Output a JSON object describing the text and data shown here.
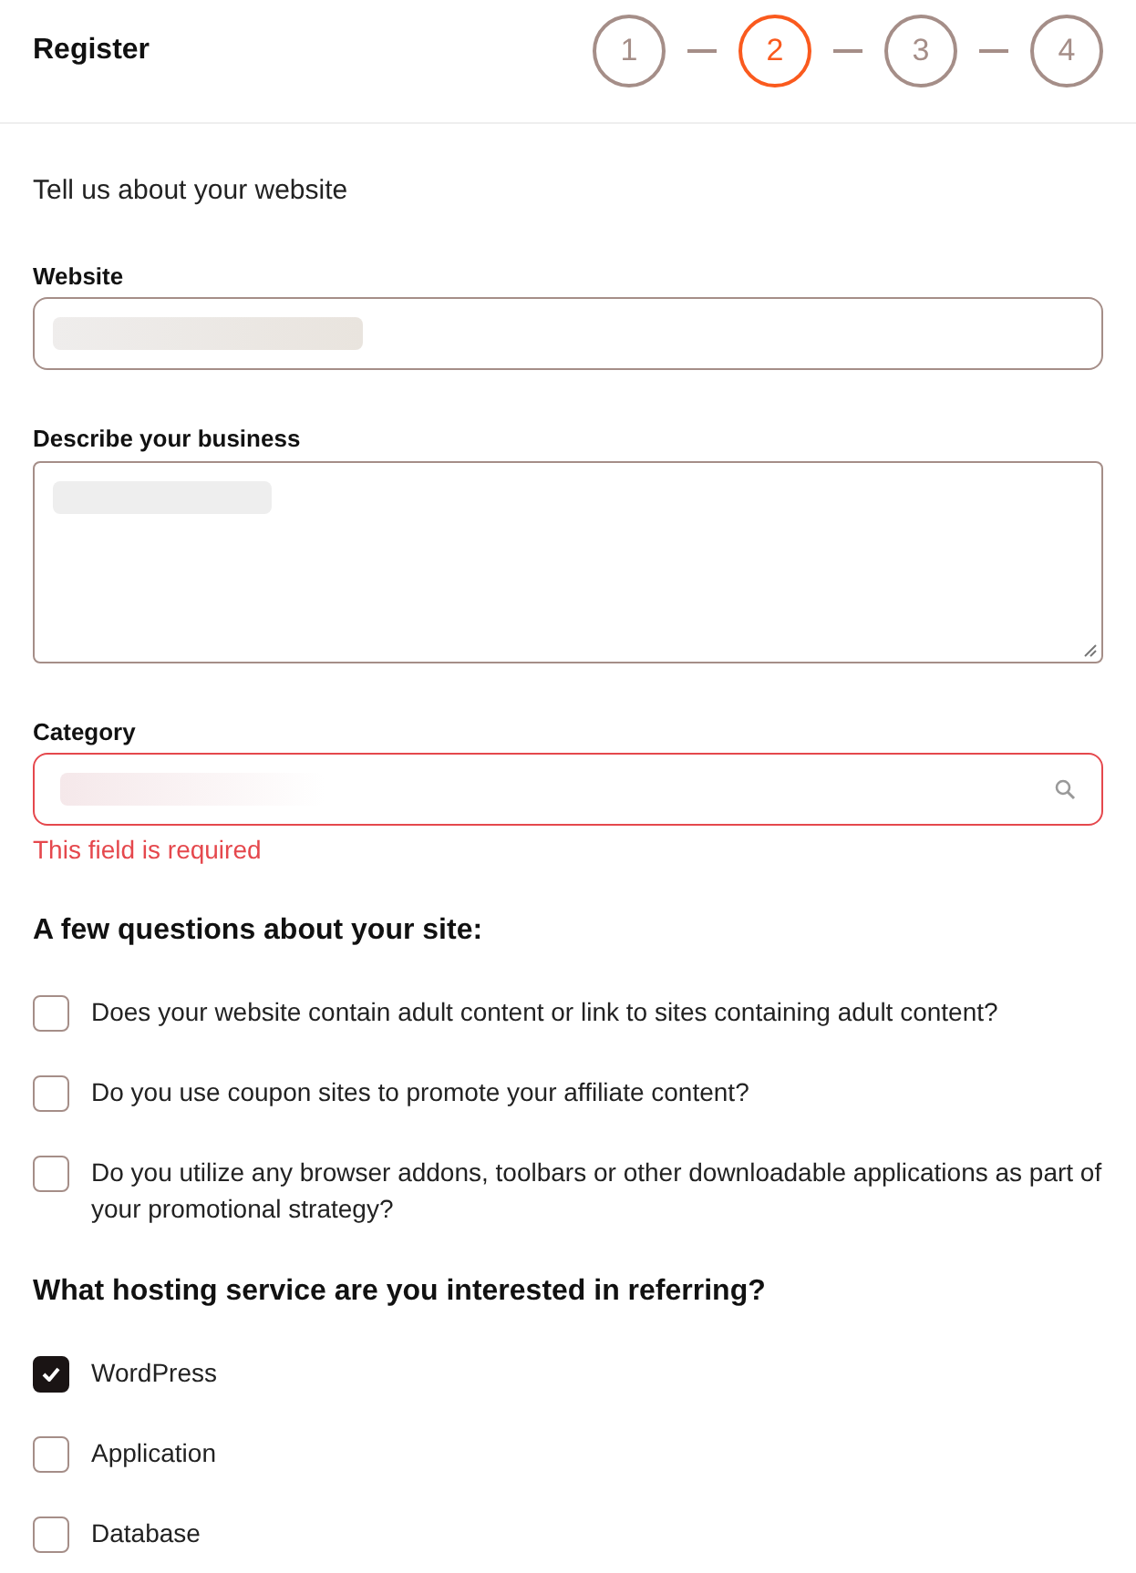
{
  "header": {
    "title": "Register",
    "steps": [
      {
        "label": "1",
        "selected": false
      },
      {
        "label": "2",
        "selected": true
      },
      {
        "label": "3",
        "selected": false
      },
      {
        "label": "4",
        "selected": false
      }
    ]
  },
  "form": {
    "heading": "Tell us about your website",
    "website": {
      "label": "Website"
    },
    "description": {
      "label": "Describe your business"
    },
    "category": {
      "label": "Category",
      "error": "This field is required"
    }
  },
  "questions": {
    "heading": "A few questions about your site:",
    "items": [
      {
        "label": "Does your website contain adult content or link to sites containing adult content?",
        "checked": false
      },
      {
        "label": "Do you use coupon sites to promote your affiliate content?",
        "checked": false
      },
      {
        "label": "Do you utilize any browser addons, toolbars or other downloadable applications as part of your promotional strategy?",
        "checked": false
      }
    ]
  },
  "hosting": {
    "heading": "What hosting service are you interested in referring?",
    "items": [
      {
        "label": "WordPress",
        "checked": true
      },
      {
        "label": "Application",
        "checked": false
      },
      {
        "label": "Database",
        "checked": false
      }
    ]
  }
}
